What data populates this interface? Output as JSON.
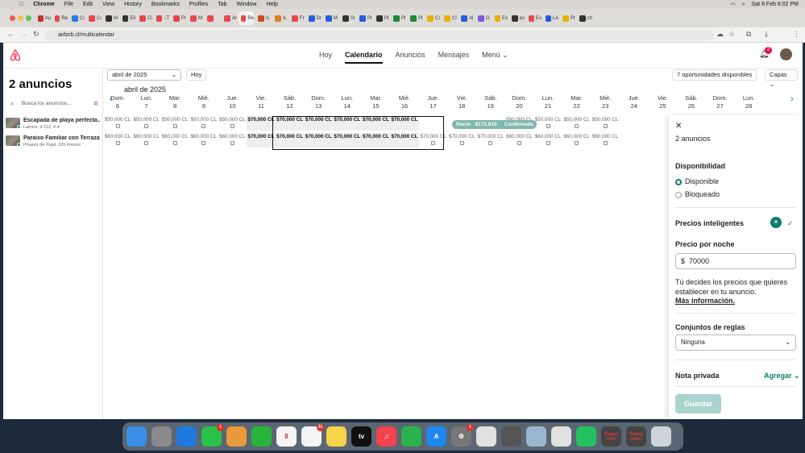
{
  "macos": {
    "app": "Chrome",
    "menus": [
      "File",
      "Edit",
      "View",
      "History",
      "Bookmarks",
      "Profiles",
      "Tab",
      "Window",
      "Help"
    ],
    "clock": "Sat 8 Feb  6:02 PM"
  },
  "browser": {
    "url": "airbnb.cl/multicalendar",
    "tabs": [
      {
        "label": "Au",
        "color": "#c4302b"
      },
      {
        "label": "Re",
        "color": "#e5484d"
      },
      {
        "label": "Cı",
        "color": "#2b7de9"
      },
      {
        "label": "Cı",
        "color": "#e5484d"
      },
      {
        "label": "M",
        "color": "#333"
      },
      {
        "label": "Eli",
        "color": "#333"
      },
      {
        "label": "Cl",
        "color": "#e5484d"
      },
      {
        "label": "↓T",
        "color": "#e5484d"
      },
      {
        "label": "Pr",
        "color": "#e5484d"
      },
      {
        "label": "M",
        "color": "#e5484d"
      },
      {
        "label": "",
        "color": "#e5484d"
      },
      {
        "label": "Ar",
        "color": "#e5484d"
      },
      {
        "label": "Re",
        "color": "#e5484d"
      },
      {
        "label": "IL",
        "color": "#c94a1e"
      },
      {
        "label": "IL",
        "color": "#e07b1e"
      },
      {
        "label": "Fr",
        "color": "#e5484d"
      },
      {
        "label": "Dr",
        "color": "#2a5bd7"
      },
      {
        "label": "M",
        "color": "#2a5bd7"
      },
      {
        "label": "Sı",
        "color": "#333"
      },
      {
        "label": "Pr",
        "color": "#2a5bd7"
      },
      {
        "label": "Pl",
        "color": "#333"
      },
      {
        "label": "Pl",
        "color": "#1b8a3a"
      },
      {
        "label": "Pl",
        "color": "#1b8a3a"
      },
      {
        "label": "Cı",
        "color": "#e8b007"
      },
      {
        "label": "Cl",
        "color": "#e8b007"
      },
      {
        "label": "Al",
        "color": "#2a5bd7"
      },
      {
        "label": "G",
        "color": "#7a5cd6"
      },
      {
        "label": "Es",
        "color": "#e8b007"
      },
      {
        "label": "es",
        "color": "#333"
      },
      {
        "label": "Es",
        "color": "#e5484d"
      },
      {
        "label": "LA",
        "color": "#2a5bd7"
      },
      {
        "label": "Pr",
        "color": "#e8b007"
      },
      {
        "label": "ch",
        "color": "#333"
      }
    ]
  },
  "header": {
    "nav": [
      "Hoy",
      "Calendario",
      "Anuncios",
      "Mensajes",
      "Menú"
    ],
    "active": "Calendario",
    "notif_count": "2"
  },
  "sidebar": {
    "title": "2 anuncios",
    "search_placeholder": "Busca los anuncios...",
    "listings": [
      {
        "name": "Escapada de playa perfecta...",
        "sub": "Latorre, d 113, 4-4"
      },
      {
        "name": "Paraíso Familiar con Terraza",
        "sub": "Pinares de Pujal, 226 Fresno"
      }
    ]
  },
  "toolbar": {
    "month_select": "abril de 2025",
    "today_btn": "Hoy",
    "opportunities": "7 oportunidades disponibles",
    "layers": "Capas"
  },
  "calendar": {
    "month_label": "abril de 2025",
    "days": [
      {
        "dow": "Dom.",
        "num": "6"
      },
      {
        "dow": "Lun.",
        "num": "7"
      },
      {
        "dow": "Mar.",
        "num": "8"
      },
      {
        "dow": "Mié.",
        "num": "9"
      },
      {
        "dow": "Jue.",
        "num": "10"
      },
      {
        "dow": "Vie.",
        "num": "11"
      },
      {
        "dow": "Sáb.",
        "num": "12"
      },
      {
        "dow": "Dom.",
        "num": "13"
      },
      {
        "dow": "Lun.",
        "num": "14"
      },
      {
        "dow": "Mar.",
        "num": "15"
      },
      {
        "dow": "Mié.",
        "num": "16"
      },
      {
        "dow": "Jue.",
        "num": "17"
      },
      {
        "dow": "Vie.",
        "num": "18"
      },
      {
        "dow": "Sáb.",
        "num": "19"
      },
      {
        "dow": "Dom.",
        "num": "20"
      },
      {
        "dow": "Lun.",
        "num": "21"
      },
      {
        "dow": "Mar.",
        "num": "22"
      },
      {
        "dow": "Mié.",
        "num": "23"
      },
      {
        "dow": "Jue.",
        "num": "24"
      },
      {
        "dow": "Vie.",
        "num": "25"
      },
      {
        "dow": "Sáb.",
        "num": "26"
      },
      {
        "dow": "Dom.",
        "num": "27"
      },
      {
        "dow": "Lun.",
        "num": "28"
      }
    ],
    "row1": [
      "$50,000 CL",
      "$50,000 CL",
      "$50,000 CL",
      "$50,000 CL",
      "$50,000 CL",
      "$70,000 CL",
      "$70,000 CL",
      "$70,000 CL",
      "$70,000 CL",
      "$70,000 CL",
      "$70,000 CL",
      "",
      "",
      "",
      "$50,000 CL",
      "$50,000 CL",
      "$50,000 CL",
      "$50,000 CL"
    ],
    "row2": [
      "$60,000 CL",
      "$60,000 CL",
      "$60,000 CL",
      "$60,000 CL",
      "$60,000 CL",
      "$70,000 CL",
      "$70,000 CL",
      "$70,000 CL",
      "$70,000 CL",
      "$70,000 CL",
      "$70,000 CL",
      "$70,000 CL",
      "$70,000 CL",
      "$70,000 CL",
      "$60,000 CL",
      "$60,000 CL",
      "$60,000 CL",
      "$60,000 CL"
    ],
    "booking": {
      "guest": "Rocio",
      "amount": "$172,610",
      "status": "Confirmada"
    }
  },
  "panel": {
    "subtitle": "2 anuncios",
    "availability_title": "Disponibilidad",
    "available": "Disponible",
    "blocked": "Bloqueado",
    "smart_prices": "Precios inteligentes",
    "price_title": "Precio por noche",
    "currency": "$",
    "price_value": "70000",
    "info_text": "Tú decides los precios que quieres establecer en tu anuncio.",
    "more_info": "Más información.",
    "rules_title": "Conjuntos de reglas",
    "rules_value": "Ninguna",
    "note_title": "Nota privada",
    "add_label": "Agregar",
    "save_label": "Guardar"
  },
  "dock": {
    "apps": [
      {
        "name": "finder",
        "label": "",
        "color": "#3a8ee6"
      },
      {
        "name": "launchpad",
        "label": "",
        "color": "#8a8a8a"
      },
      {
        "name": "safari",
        "label": "",
        "color": "#1f7ae0"
      },
      {
        "name": "messages",
        "label": "",
        "color": "#2bc24a",
        "badge": "1"
      },
      {
        "name": "photos",
        "label": "",
        "color": "#e99a3a"
      },
      {
        "name": "facetime",
        "label": "",
        "color": "#27b43d"
      },
      {
        "name": "calendar",
        "label": "8",
        "color": "#f4f4f4"
      },
      {
        "name": "reminders",
        "label": "",
        "color": "#f4f4f4",
        "badge": "31"
      },
      {
        "name": "notes",
        "label": "",
        "color": "#f6d44a"
      },
      {
        "name": "tv",
        "label": "tv",
        "color": "#111"
      },
      {
        "name": "music",
        "label": "♫",
        "color": "#f2434f"
      },
      {
        "name": "numbers",
        "label": "",
        "color": "#2bb34b"
      },
      {
        "name": "app-store",
        "label": "A",
        "color": "#1e87f0"
      },
      {
        "name": "system-settings",
        "label": "⚙",
        "color": "#777",
        "badge": "1"
      },
      {
        "name": "chrome",
        "label": "",
        "color": "#e0e0e0"
      },
      {
        "name": "calculator",
        "label": "",
        "color": "#555"
      },
      {
        "name": "preview",
        "label": "",
        "color": "#9bb7cf"
      },
      {
        "name": "chrome-2",
        "label": "",
        "color": "#e0e0e0"
      },
      {
        "name": "whatsapp",
        "label": "",
        "color": "#25c160"
      },
      {
        "name": "projectlibre",
        "label": "Project Libre",
        "color": "#444"
      },
      {
        "name": "projectlibre-2",
        "label": "Project Libre",
        "color": "#444"
      },
      {
        "name": "trash",
        "label": "",
        "color": "#cfd4da"
      }
    ]
  }
}
